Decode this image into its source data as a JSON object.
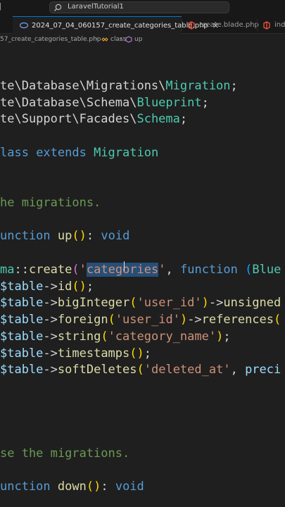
{
  "titlebar": {
    "search_text": "LaravelTutorial1"
  },
  "tabs": [
    {
      "label": "2024_07_04_060157_create_categories_table.php",
      "close": "✕",
      "active": true
    },
    {
      "label": "create.blade.php",
      "active": false
    },
    {
      "label": "inde",
      "active": false
    }
  ],
  "breadcrumb": {
    "file": "57_create_categories_table.php",
    "class_label": "class",
    "method_label": "up"
  },
  "code": {
    "l1": [
      "te\\Database\\Migrations\\",
      "Migration",
      ";"
    ],
    "l2": [
      "te\\Database\\Schema\\",
      "Blueprint",
      ";"
    ],
    "l3": [
      "te\\Support\\Facades\\",
      "Schema",
      ";"
    ],
    "l4": [
      "lass ",
      "extends ",
      "Migration"
    ],
    "l5": "he migrations.",
    "l6": [
      "unction ",
      "up",
      "(",
      ")",
      ": ",
      "void"
    ],
    "l7": [
      "ma",
      "::",
      "create",
      "(",
      "'",
      "categories",
      "'",
      ", ",
      "function ",
      "(",
      "Blue"
    ],
    "l8": [
      "$table",
      "->",
      "id",
      "(",
      ")",
      ";"
    ],
    "l9": [
      "$table",
      "->",
      "bigInteger",
      "(",
      "'user_id'",
      ")",
      "->",
      "unsigned"
    ],
    "l10": [
      "$table",
      "->",
      "foreign",
      "(",
      "'user_id'",
      ")",
      "->",
      "references",
      "("
    ],
    "l11": [
      "$table",
      "->",
      "string",
      "(",
      "'category_name'",
      ")",
      ";"
    ],
    "l12": [
      "$table",
      "->",
      "timestamps",
      "(",
      ")",
      ";"
    ],
    "l13": [
      "$table",
      "->",
      "softDeletes",
      "(",
      "'deleted_at'",
      ", ",
      "preci"
    ],
    "l14": "se the migrations.",
    "l15": [
      "unction ",
      "down",
      "(",
      ")",
      ": ",
      "void"
    ]
  }
}
